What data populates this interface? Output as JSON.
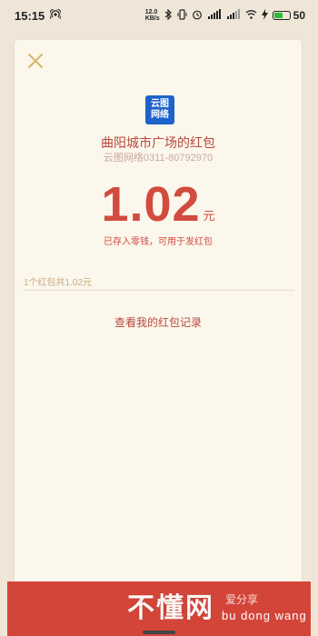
{
  "statusbar": {
    "time": "15:15",
    "battery": "50",
    "network_speed": "12.0\nKB/s"
  },
  "redpacket": {
    "logo_line1": "云图",
    "logo_line2": "网络",
    "title": "曲阳城市广场的红包",
    "subtitle": "云图网络0311-80792970",
    "amount": "1.02",
    "unit": "元",
    "note": "已存入零钱，可用于发红包",
    "summary": "1个红包共1.02元",
    "record_link": "查看我的红包记录"
  },
  "watermark": {
    "cn": "不懂网",
    "side": "爱分享",
    "en": "bu dong wang"
  },
  "colors": {
    "accent": "#d24b3f",
    "background": "#efe6d8",
    "card": "#fbf7ec",
    "logo_blue": "#1e63c9"
  }
}
